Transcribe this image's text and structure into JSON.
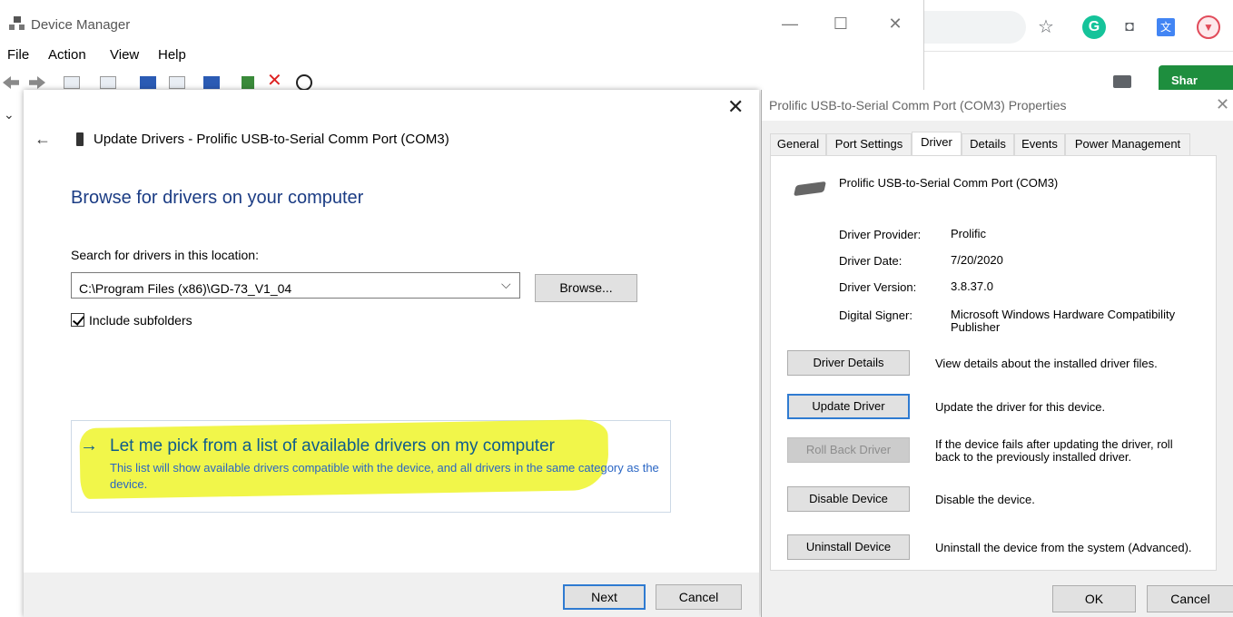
{
  "device_manager": {
    "title": "Device Manager",
    "window_controls": {
      "minimize": "—",
      "maximize": "☐",
      "close": "✕"
    },
    "menu": [
      "File",
      "Action",
      "View",
      "Help"
    ]
  },
  "browser": {
    "share_label": "Shar"
  },
  "wizard": {
    "close": "✕",
    "back": "←",
    "title": "Update Drivers - Prolific USB-to-Serial Comm Port (COM3)",
    "heading": "Browse for drivers on your computer",
    "search_label": "Search for drivers in this location:",
    "path_value": "C:\\Program Files (x86)\\GD-73_V1_04",
    "browse_label": "Browse...",
    "include_subfolders_label": "Include subfolders",
    "include_subfolders_checked": true,
    "pick_arrow": "→",
    "pick_title": "Let me pick from a list of available drivers on my computer",
    "pick_description": "This list will show available drivers compatible with the device, and all drivers in the same category as the device.",
    "next_label": "Next",
    "cancel_label": "Cancel",
    "highlight_color": "#eef42a"
  },
  "properties": {
    "title": "Prolific USB-to-Serial Comm Port (COM3) Properties",
    "close": "✕",
    "tabs": [
      "General",
      "Port Settings",
      "Driver",
      "Details",
      "Events",
      "Power Management"
    ],
    "active_tab": "Driver",
    "device_name": "Prolific USB-to-Serial Comm Port (COM3)",
    "fields": [
      {
        "label": "Driver Provider:",
        "value": "Prolific"
      },
      {
        "label": "Driver Date:",
        "value": "7/20/2020"
      },
      {
        "label": "Driver Version:",
        "value": "3.8.37.0"
      },
      {
        "label": "Digital Signer:",
        "value": "Microsoft Windows Hardware Compatibility Publisher"
      }
    ],
    "actions": [
      {
        "label": "Driver Details",
        "description": "View details about the installed driver files."
      },
      {
        "label": "Update Driver",
        "description": "Update the driver for this device."
      },
      {
        "label": "Roll Back Driver",
        "description": "If the device fails after updating the driver, roll back to the previously installed driver."
      },
      {
        "label": "Disable Device",
        "description": "Disable the device."
      },
      {
        "label": "Uninstall Device",
        "description": "Uninstall the device from the system (Advanced)."
      }
    ],
    "ok_label": "OK",
    "cancel_label": "Cancel"
  }
}
